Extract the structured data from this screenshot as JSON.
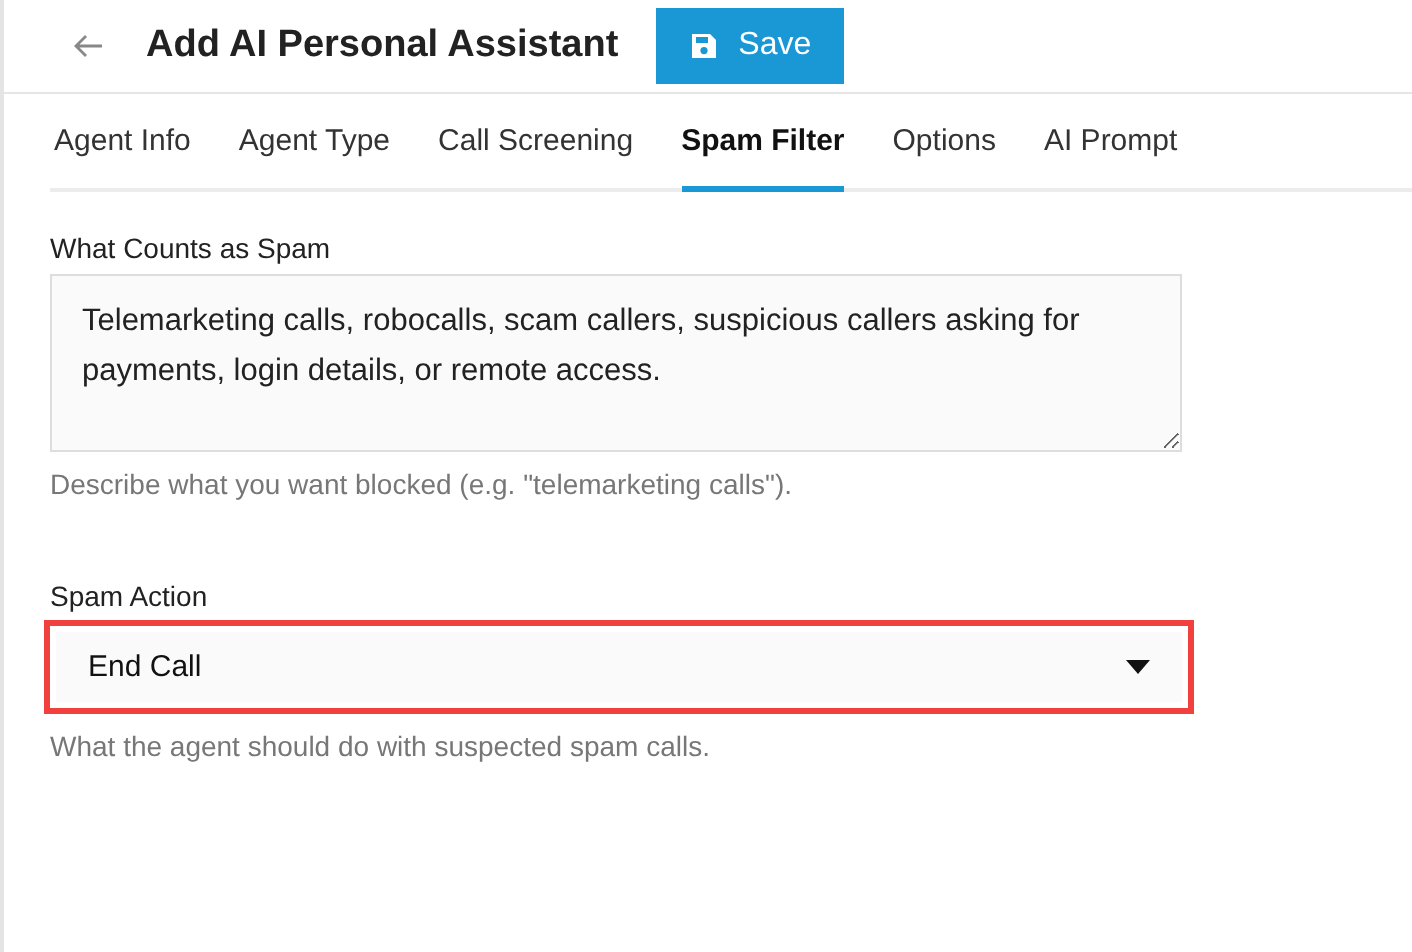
{
  "header": {
    "title": "Add AI Personal Assistant",
    "save_button": "Save"
  },
  "tabs": [
    {
      "label": "Agent Info",
      "selected": false
    },
    {
      "label": "Agent Type",
      "selected": false
    },
    {
      "label": "Call Screening",
      "selected": false
    },
    {
      "label": "Spam Filter",
      "selected": true
    },
    {
      "label": "Options",
      "selected": false
    },
    {
      "label": "AI Prompt",
      "selected": false
    }
  ],
  "spam_definition": {
    "label": "What Counts as Spam",
    "value": "Telemarketing calls, robocalls, scam callers, suspicious callers asking for payments, login details, or remote access.",
    "help": "Describe what you want blocked (e.g. \"telemarketing calls\")."
  },
  "spam_action": {
    "label": "Spam Action",
    "value": "End Call",
    "highlighted": true,
    "help": "What the agent should do with suspected spam calls."
  }
}
